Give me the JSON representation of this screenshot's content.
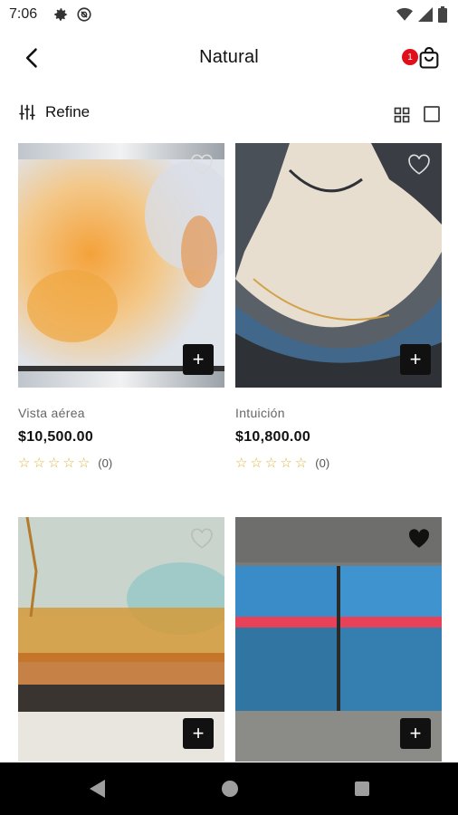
{
  "status_bar": {
    "time": "7:06",
    "icons": [
      "settings-icon",
      "no-disturb-icon",
      "wifi-icon",
      "signal-icon",
      "battery-icon"
    ]
  },
  "app_bar": {
    "title": "Natural",
    "cart_badge_count": "1",
    "accent_color": "#e0101a"
  },
  "toolbar": {
    "refine_label": "Refine",
    "view_modes": [
      "grid-view",
      "single-view"
    ]
  },
  "products": [
    {
      "name": "Vista aérea",
      "price": "$10,500.00",
      "rating_count": "(0)",
      "favorited": false
    },
    {
      "name": "Intuición",
      "price": "$10,800.00",
      "rating_count": "(0)",
      "favorited": false
    },
    {
      "name": "",
      "price": "",
      "rating_count": "",
      "favorited": false
    },
    {
      "name": "",
      "price": "",
      "rating_count": "",
      "favorited": true
    }
  ],
  "add_button_label": "+",
  "nav_bar": {
    "buttons": [
      "back-triangle-icon",
      "home-circle-icon",
      "recents-square-icon"
    ]
  }
}
